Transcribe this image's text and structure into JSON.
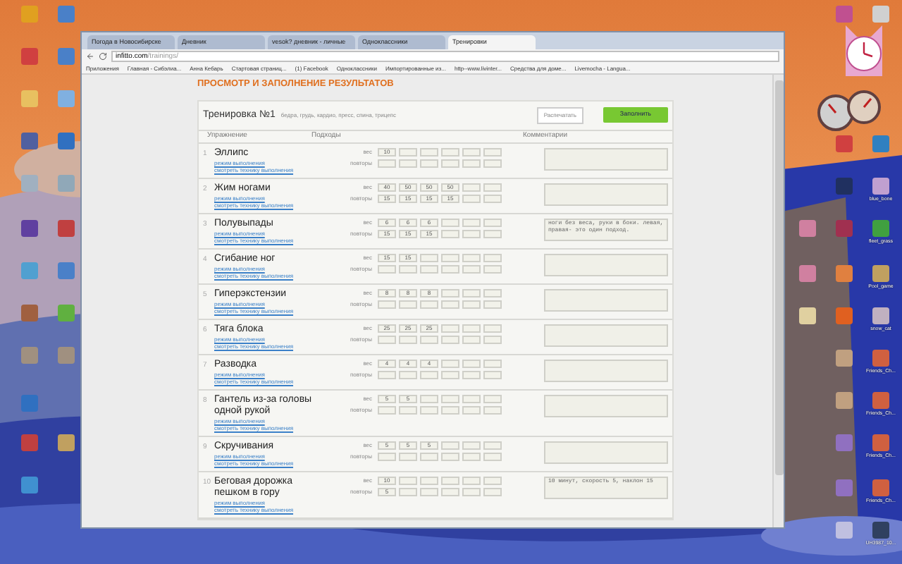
{
  "desktop_icons": [
    {
      "color": "#e0a020"
    },
    {
      "color": "#4a80c8"
    },
    {
      "color": "#d04040"
    },
    {
      "color": "#4a80c8"
    },
    {
      "color": "#e8c060"
    },
    {
      "color": "#80b0e0"
    },
    {
      "color": "#5060a0"
    },
    {
      "color": "#3070c0"
    },
    {
      "color": "#a0b0c0"
    },
    {
      "color": "#90a8b8"
    },
    {
      "color": "#6040a0"
    },
    {
      "color": "#c04040"
    },
    {
      "color": "#50a0d0"
    },
    {
      "color": "#4a80c8"
    },
    {
      "color": "#a06040"
    },
    {
      "color": "#60b040"
    },
    {
      "color": "#a09080"
    },
    {
      "color": "#a09080"
    },
    {
      "color": "#3070c0"
    },
    {
      "color": "#c04040"
    },
    {
      "color": "#c0a060"
    },
    {
      "color": "#4090d0"
    },
    {
      "color": "#c05090"
    },
    {
      "color": "#d0d0d0"
    },
    {
      "color": "#d04040"
    },
    {
      "color": "#3080c0"
    },
    {
      "color": "#203060"
    },
    {
      "color": "#c0a0d0",
      "label": "blue_bone"
    },
    {
      "color": "#d080a0"
    },
    {
      "color": "#a03050"
    },
    {
      "color": "#40a040",
      "label": "fleet_grass"
    },
    {
      "color": "#d080a0"
    },
    {
      "color": "#e08040"
    },
    {
      "color": "#c0a060",
      "label": "Pool_game"
    },
    {
      "color": "#e0d0a0"
    },
    {
      "color": "#e06020"
    },
    {
      "color": "#c0b0c0",
      "label": "snow_cat"
    },
    {
      "color": "#c0a080"
    },
    {
      "color": "#d06040",
      "label": "Friends_Ch..."
    },
    {
      "color": "#c0a080"
    },
    {
      "color": "#d06040",
      "label": "Friends_Ch..."
    },
    {
      "color": "#9070c0"
    },
    {
      "color": "#d06040",
      "label": "Friends_Ch..."
    },
    {
      "color": "#9070c0"
    },
    {
      "color": "#d06040",
      "label": "Friends_Ch..."
    },
    {
      "color": "#c0c0e0"
    },
    {
      "color": "#304060",
      "label": "UH3987_10..."
    }
  ],
  "browser": {
    "tabs": [
      {
        "label": "Погода в Новосибирске",
        "selected": false
      },
      {
        "label": "Дневник",
        "selected": false
      },
      {
        "label": "vesok? дневник - личные",
        "selected": false
      },
      {
        "label": "Одноклассники",
        "selected": false
      },
      {
        "label": "Тренировки",
        "selected": true
      }
    ],
    "url_domain": "infitto.com",
    "url_path": "/trainings/",
    "bookmarks": [
      "Приложения",
      "Главная - Сибэлиа...",
      "Анна Кебарь",
      "Стартовая страниц...",
      "(1) Facebook",
      "Одноклассники",
      "Импортированные из...",
      "http--www.livinter...",
      "Средства для доме...",
      "Livemocha - Langua..."
    ]
  },
  "page": {
    "heading": "ПРОСМОТР И ЗАПОЛНЕНИЕ РЕЗУЛЬТАТОВ",
    "workout_title": "Тренировка №1",
    "workout_tags": "бедра, грудь, кардио, пресс, спина, трицепс",
    "print_button": "Распечатать",
    "fill_button": "Заполнить",
    "columns": {
      "exercise": "Упражнение",
      "sets": "Подходы",
      "comments": "Комментарии"
    },
    "rows": [
      {
        "number": "1",
        "name_lines": [
          "Эллипс"
        ],
        "links": [
          "режим выполнения",
          "смотреть технику выполнения"
        ],
        "weight_label": "вес",
        "reps_label": "повторы",
        "weight": [
          "10"
        ],
        "reps": []
      },
      {
        "number": "2",
        "name_lines": [
          "Жим ногами"
        ],
        "links": [
          "режим выполнения",
          "смотреть технику выполнения"
        ],
        "weight_label": "вес",
        "reps_label": "повторы",
        "weight": [
          "40",
          "50",
          "50",
          "50"
        ],
        "reps": [
          "15",
          "15",
          "15",
          "15"
        ]
      },
      {
        "number": "3",
        "name_lines": [
          "Полувыпады"
        ],
        "links": [
          "режим выполнения",
          "смотреть технику выполнения"
        ],
        "weight_label": "вес",
        "reps_label": "повторы",
        "weight": [
          "6",
          "6",
          "6"
        ],
        "reps": [
          "15",
          "15",
          "15"
        ],
        "comment": "ноги без веса, руки в боки. левая, правая- это один подход."
      },
      {
        "number": "4",
        "name_lines": [
          "Сгибание ног"
        ],
        "links": [
          "режим выполнения",
          "смотреть технику выполнения"
        ],
        "weight_label": "вес",
        "reps_label": "повторы",
        "weight": [
          "15",
          "15"
        ],
        "reps": []
      },
      {
        "number": "5",
        "name_lines": [
          "Гиперэкстензии"
        ],
        "links": [
          "режим выполнения",
          "смотреть технику выполнения"
        ],
        "weight_label": "вес",
        "reps_label": "повторы",
        "weight": [
          "8",
          "8",
          "8"
        ],
        "reps": []
      },
      {
        "number": "6",
        "name_lines": [
          "Тяга блока"
        ],
        "links": [
          "режим выполнения",
          "смотреть технику выполнения"
        ],
        "weight_label": "вес",
        "reps_label": "повторы",
        "weight": [
          "25",
          "25",
          "25"
        ],
        "reps": []
      },
      {
        "number": "7",
        "name_lines": [
          "Разводка"
        ],
        "links": [
          "режим выполнения",
          "смотреть технику выполнения"
        ],
        "weight_label": "вес",
        "reps_label": "повторы",
        "weight": [
          "4",
          "4",
          "4"
        ],
        "reps": []
      },
      {
        "number": "8",
        "name_lines": [
          "Гантель из-за головы",
          "одной рукой"
        ],
        "links": [
          "режим выполнения",
          "смотреть технику выполнения"
        ],
        "weight_label": "вес",
        "reps_label": "повторы",
        "weight": [
          "5",
          "5"
        ],
        "reps": []
      },
      {
        "number": "9",
        "name_lines": [
          "Скручивания"
        ],
        "links": [
          "режим выполнения",
          "смотреть технику выполнения"
        ],
        "weight_label": "вес",
        "reps_label": "повторы",
        "weight": [
          "5",
          "5",
          "5"
        ],
        "reps": []
      },
      {
        "number": "10",
        "name_lines": [
          "Беговая дорожка",
          "пешком в гору"
        ],
        "links": [
          "режим выполнения",
          "смотреть технику выполнения"
        ],
        "weight_label": "вес",
        "reps_label": "повторы",
        "weight": [
          "10"
        ],
        "reps": [
          "5"
        ],
        "comment": "10 минут, скорость 5, наклон 15"
      }
    ]
  }
}
